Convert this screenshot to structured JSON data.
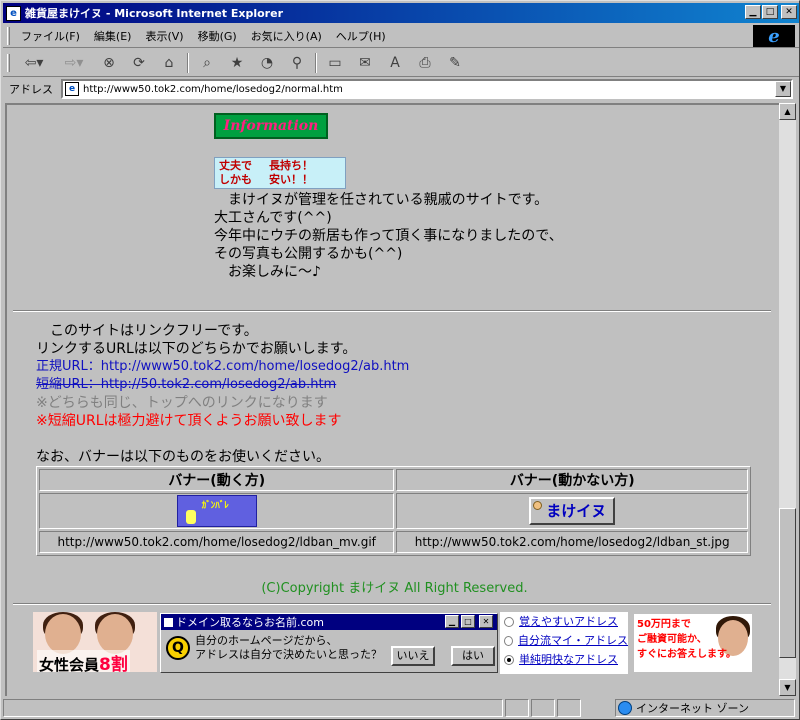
{
  "window": {
    "title": "雑貨屋まけイヌ - Microsoft Internet Explorer"
  },
  "menu": [
    "ファイル(F)",
    "編集(E)",
    "表示(V)",
    "移動(G)",
    "お気に入り(A)",
    "ヘルプ(H)"
  ],
  "address": {
    "label": "アドレス",
    "url": "http://www50.tok2.com/home/losedog2/normal.htm"
  },
  "content": {
    "info_banner": "Information",
    "ad_banner": [
      "丈夫で",
      "長持ち！",
      "しかも",
      "安い！！"
    ],
    "info_lines": [
      "　まけイヌが管理を任されている親戚のサイトです。",
      "大工さんです(^^)",
      "今年中にウチの新居も作って頂く事になりましたので、",
      "その写真も公開するかも(^^)",
      "　お楽しみに～♪"
    ],
    "link_lines": {
      "free": "　このサイトはリンクフリーです。",
      "request": "リンクするURLは以下のどちらかでお願いします。",
      "formal_label": "正規URL：",
      "formal_url": "http://www50.tok2.com/home/losedog2/ab.htm",
      "short_label": "短縮URL：",
      "short_url": "http://50.tok2.com/losedog2/ab.htm",
      "note_gray": "※どちらも同じ、トップへのリンクになります",
      "note_red": "※短縮URLは極力避けて頂くようお願い致します",
      "banner_request": "なお、バナーは以下のものをお使いください。"
    },
    "banner_table": {
      "head_moving": "バナー(動く方)",
      "head_static": "バナー(動かない方)",
      "moving_banner_text": "ｶﾞﾝﾊﾞﾚ",
      "static_banner_text": "まけイヌ",
      "url_moving": "http://www50.tok2.com/home/losedog2/ldban_mv.gif",
      "url_static": "http://www50.tok2.com/home/losedog2/ldban_st.jpg"
    },
    "copyright": "(C)Copyright まけイヌ All Right Reserved."
  },
  "ads": {
    "women": {
      "text": "女性会員",
      "highlight": "8割"
    },
    "domain": {
      "title": "ドメイン取るならお名前.com",
      "q": "Q",
      "msg1": "自分のホームページだから、",
      "msg2": "アドレスは自分で決めたいと思った？",
      "no": "いいえ",
      "yes": "はい"
    },
    "radio": [
      "覚えやすいアドレス",
      "自分流マイ・アドレス",
      "単純明快なアドレス"
    ],
    "loan": [
      "50万円まで",
      "ご融資可能か、",
      "すぐにお答えします。"
    ]
  },
  "status": {
    "zone": "インターネット ゾーン"
  }
}
